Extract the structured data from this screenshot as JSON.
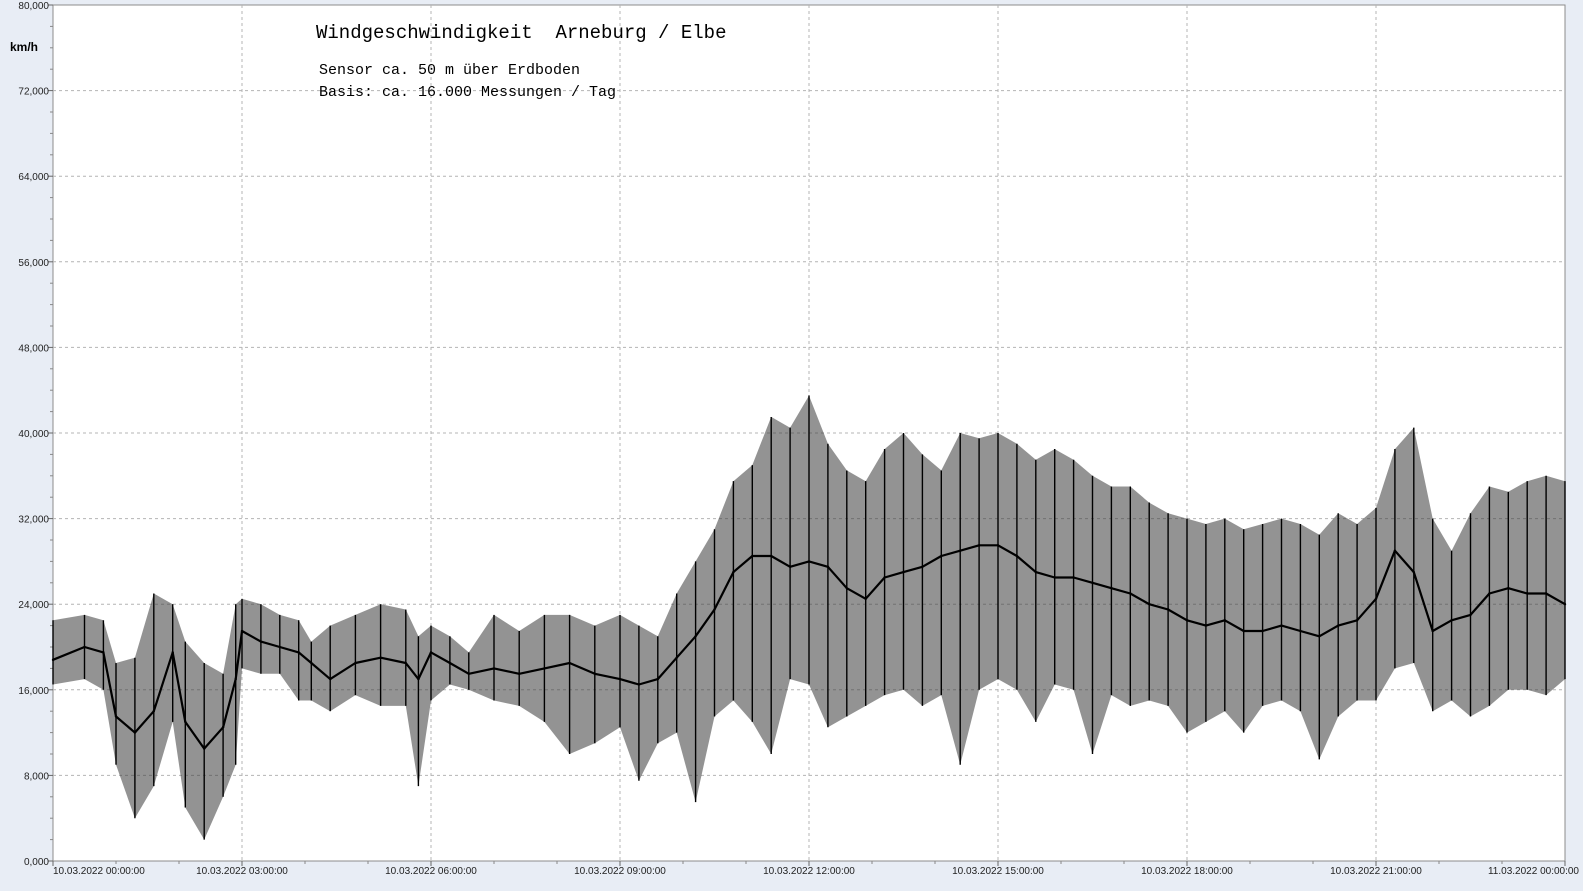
{
  "chart_data": {
    "type": "line",
    "title": "Windgeschwindigkeit  Arneburg / Elbe",
    "subtitle_lines": [
      "Sensor ca. 50 m über Erdboden",
      "Basis: ca. 16.000 Messungen / Tag"
    ],
    "ylabel": "km/h",
    "ylim": [
      0,
      80
    ],
    "y_ticks": [
      {
        "value": 0,
        "label": "0,000"
      },
      {
        "value": 8,
        "label": "8,000"
      },
      {
        "value": 16,
        "label": "16,000"
      },
      {
        "value": 24,
        "label": "24,000"
      },
      {
        "value": 32,
        "label": "32,000"
      },
      {
        "value": 40,
        "label": "40,000"
      },
      {
        "value": 48,
        "label": "48,000"
      },
      {
        "value": 56,
        "label": "56,000"
      },
      {
        "value": 64,
        "label": "64,000"
      },
      {
        "value": 72,
        "label": "72,000"
      },
      {
        "value": 80,
        "label": "80,000"
      }
    ],
    "xlim": [
      0,
      24
    ],
    "x_ticks": [
      {
        "value": 0,
        "label": "10.03.2022  00:00:00"
      },
      {
        "value": 3,
        "label": "10.03.2022  03:00:00"
      },
      {
        "value": 6,
        "label": "10.03.2022  06:00:00"
      },
      {
        "value": 9,
        "label": "10.03.2022  09:00:00"
      },
      {
        "value": 12,
        "label": "10.03.2022  12:00:00"
      },
      {
        "value": 15,
        "label": "10.03.2022  15:00:00"
      },
      {
        "value": 18,
        "label": "10.03.2022  18:00:00"
      },
      {
        "value": 21,
        "label": "10.03.2022  21:00:00"
      },
      {
        "value": 24,
        "label": "11.03.2022  00:00:00"
      }
    ],
    "grid": true,
    "series": [
      {
        "color": "#000000",
        "x": [
          0.0,
          0.5,
          0.8,
          1.0,
          1.3,
          1.6,
          1.9,
          2.1,
          2.4,
          2.7,
          2.9,
          3.0,
          3.3,
          3.6,
          3.9,
          4.1,
          4.4,
          4.8,
          5.2,
          5.6,
          5.8,
          6.0,
          6.3,
          6.6,
          7.0,
          7.4,
          7.8,
          8.2,
          8.6,
          9.0,
          9.3,
          9.6,
          9.9,
          10.2,
          10.5,
          10.8,
          11.1,
          11.4,
          11.7,
          12.0,
          12.3,
          12.6,
          12.9,
          13.2,
          13.5,
          13.8,
          14.1,
          14.4,
          14.7,
          15.0,
          15.3,
          15.6,
          15.9,
          16.2,
          16.5,
          16.8,
          17.1,
          17.4,
          17.7,
          18.0,
          18.3,
          18.6,
          18.9,
          19.2,
          19.5,
          19.8,
          20.1,
          20.4,
          20.7,
          21.0,
          21.3,
          21.6,
          21.9,
          22.2,
          22.5,
          22.8,
          23.1,
          23.4,
          23.7,
          24.0
        ],
        "y": [
          18.8,
          20.0,
          19.5,
          13.5,
          12.0,
          14.0,
          19.5,
          13.0,
          10.5,
          12.5,
          17.0,
          21.5,
          20.5,
          20.0,
          19.5,
          18.5,
          17.0,
          18.5,
          19.0,
          18.5,
          17.0,
          19.5,
          18.5,
          17.5,
          18.0,
          17.5,
          18.0,
          18.5,
          17.5,
          17.0,
          16.5,
          17.0,
          19.0,
          21.0,
          23.5,
          27.0,
          28.5,
          28.5,
          27.5,
          28.0,
          27.5,
          25.5,
          24.5,
          26.5,
          27.0,
          27.5,
          28.5,
          29.0,
          29.5,
          29.5,
          28.5,
          27.0,
          26.5,
          26.5,
          26.0,
          25.5,
          25.0,
          24.0,
          23.5,
          22.5,
          22.0,
          22.5,
          21.5,
          21.5,
          22.0,
          21.5,
          21.0,
          22.0,
          22.5,
          24.5,
          29.0,
          27.0,
          21.5,
          22.5,
          23.0,
          25.0,
          25.5,
          25.0,
          25.0,
          24.0
        ],
        "envelope_max": [
          22.5,
          23.0,
          22.5,
          18.5,
          19.0,
          25.0,
          24.0,
          20.5,
          18.5,
          17.5,
          24.0,
          24.5,
          24.0,
          23.0,
          22.5,
          20.5,
          22.0,
          23.0,
          24.0,
          23.5,
          21.0,
          22.0,
          21.0,
          19.5,
          23.0,
          21.5,
          23.0,
          23.0,
          22.0,
          23.0,
          22.0,
          21.0,
          25.0,
          28.0,
          31.0,
          35.5,
          37.0,
          41.5,
          40.5,
          43.5,
          39.0,
          36.5,
          35.5,
          38.5,
          40.0,
          38.0,
          36.5,
          40.0,
          39.5,
          40.0,
          39.0,
          37.5,
          38.5,
          37.5,
          36.0,
          35.0,
          35.0,
          33.5,
          32.5,
          32.0,
          31.5,
          32.0,
          31.0,
          31.5,
          32.0,
          31.5,
          30.5,
          32.5,
          31.5,
          33.0,
          38.5,
          40.5,
          32.0,
          29.0,
          32.5,
          35.0,
          34.5,
          35.5,
          36.0,
          35.5
        ],
        "envelope_min": [
          16.5,
          17.0,
          16.0,
          9.0,
          4.0,
          7.0,
          13.0,
          5.0,
          2.0,
          6.0,
          9.0,
          18.0,
          17.5,
          17.5,
          15.0,
          15.0,
          14.0,
          15.5,
          14.5,
          14.5,
          7.0,
          15.0,
          16.5,
          16.0,
          15.0,
          14.5,
          13.0,
          10.0,
          11.0,
          12.5,
          7.5,
          11.0,
          12.0,
          5.5,
          13.5,
          15.0,
          13.0,
          10.0,
          17.0,
          16.5,
          12.5,
          13.5,
          14.5,
          15.5,
          16.0,
          14.5,
          15.5,
          9.0,
          16.0,
          17.0,
          16.0,
          13.0,
          16.5,
          16.0,
          10.0,
          15.5,
          14.5,
          15.0,
          14.5,
          12.0,
          13.0,
          14.0,
          12.0,
          14.5,
          15.0,
          14.0,
          9.5,
          13.5,
          15.0,
          15.0,
          18.0,
          18.5,
          14.0,
          15.0,
          13.5,
          14.5,
          16.0,
          16.0,
          15.5,
          17.0
        ]
      }
    ]
  }
}
